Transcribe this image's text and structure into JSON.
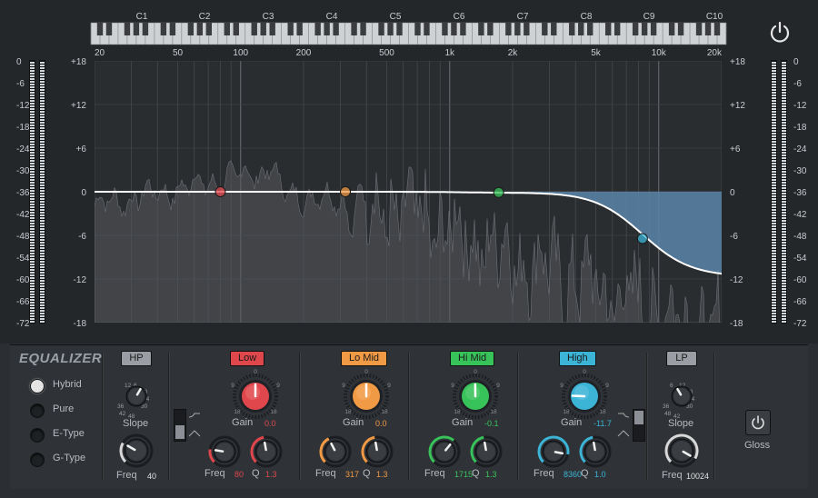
{
  "piano_notes": [
    "C1",
    "C2",
    "C3",
    "C4",
    "C5",
    "C6",
    "C7",
    "C8",
    "C9",
    "C10"
  ],
  "freq_labels": [
    "20",
    "50",
    "100",
    "200",
    "500",
    "1k",
    "2k",
    "5k",
    "10k",
    "20k"
  ],
  "db_labels": [
    "+18",
    "+12",
    "+6",
    "0",
    "-6",
    "-12",
    "-18"
  ],
  "meter_labels": [
    "0",
    "-6",
    "-12",
    "-18",
    "-24",
    "-30",
    "-36",
    "-42",
    "-48",
    "-54",
    "-60",
    "-66",
    "-72"
  ],
  "plugin_title": "EQUALIZER",
  "modes": [
    "Hybrid",
    "Pure",
    "E-Type",
    "G-Type"
  ],
  "active_mode": "Hybrid",
  "hp": {
    "button": "HP",
    "slope_label": "Slope",
    "slope_ticks": [
      "12",
      "6",
      "18",
      "24",
      "30",
      "36",
      "42",
      "48"
    ],
    "freq_label": "Freq",
    "freq_value": "40"
  },
  "bands": [
    {
      "name": "Low",
      "color": "#e0474c",
      "gain_label": "Gain",
      "gain_value": "0.0",
      "freq_label": "Freq",
      "freq_value": "80",
      "q_label": "Q",
      "q_value": "1.3",
      "freq_hz": 80,
      "gain_db": 0.0,
      "q": 1.3
    },
    {
      "name": "Lo Mid",
      "color": "#f09a45",
      "gain_label": "Gain",
      "gain_value": "0.0",
      "freq_label": "Freq",
      "freq_value": "317",
      "q_label": "Q",
      "q_value": "1.3",
      "freq_hz": 317,
      "gain_db": 0.0,
      "q": 1.3
    },
    {
      "name": "Hi Mid",
      "color": "#38c25a",
      "gain_label": "Gain",
      "gain_value": "-0.1",
      "freq_label": "Freq",
      "freq_value": "1715",
      "q_label": "Q",
      "q_value": "1.3",
      "freq_hz": 1715,
      "gain_db": -0.1,
      "q": 1.3
    },
    {
      "name": "High",
      "color": "#3cb4d6",
      "gain_label": "Gain",
      "gain_value": "-11.7",
      "freq_label": "Freq",
      "freq_value": "8360",
      "q_label": "Q",
      "q_value": "1.0",
      "freq_hz": 8360,
      "gain_db": -11.7,
      "q": 1.0
    }
  ],
  "knob_ticks": {
    "top": "0",
    "left": "9",
    "right": "9",
    "bl": "18",
    "br": "18"
  },
  "lp": {
    "button": "LP",
    "slope_label": "Slope",
    "slope_ticks": [
      "6",
      "12",
      "18",
      "24",
      "30",
      "36",
      "48",
      "42"
    ],
    "freq_label": "Freq",
    "freq_value": "10024"
  },
  "gloss_label": "Gloss",
  "colors": {
    "background": "#24272a",
    "panel": "#2f3337",
    "curve": "#ffffff",
    "cut_fill": "#5b85a8"
  }
}
